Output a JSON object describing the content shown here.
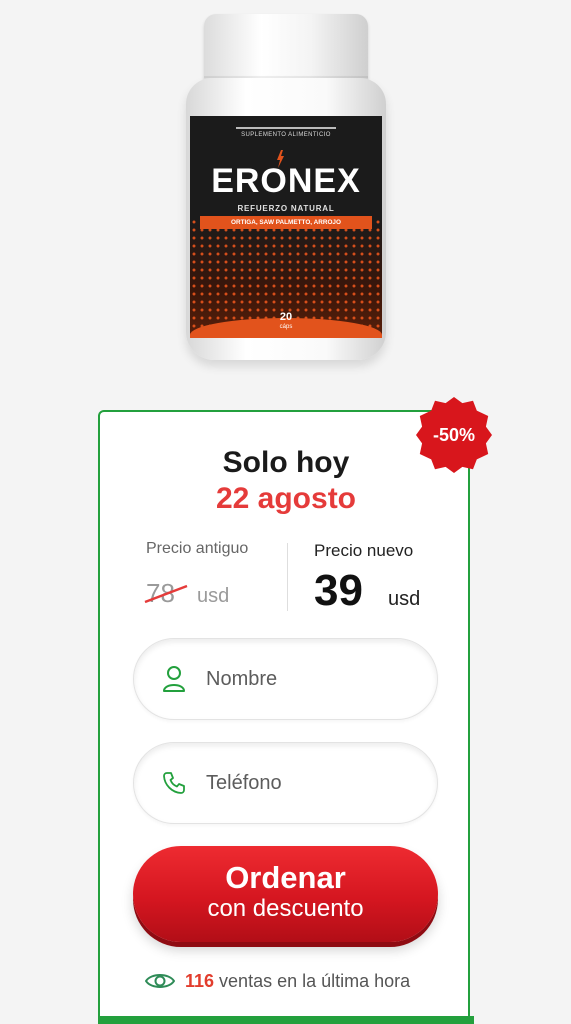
{
  "product": {
    "brand": "ERONEX",
    "label_top": "SUPLEMENTO ALIMENTICIO",
    "tagline": "REFUERZO NATURAL",
    "ingredients": "ORTIGA, SAW PALMETTO, ARROJO",
    "caps_count": "20",
    "caps_unit": "cáps"
  },
  "offer": {
    "discount_badge": "-50%",
    "title_line1": "Solo hoy",
    "title_line2": "22 agosto",
    "old_price_label": "Precio antiguo",
    "old_price_value": "78",
    "old_price_unit": "usd",
    "new_price_label": "Precio nuevo",
    "new_price_value": "39",
    "new_price_unit": "usd"
  },
  "form": {
    "name_placeholder": "Nombre",
    "phone_placeholder": "Teléfono",
    "submit_line1": "Ordenar",
    "submit_line2": "con descuento"
  },
  "sales": {
    "count": "116",
    "text": "ventas en la última hora"
  },
  "colors": {
    "accent_green": "#23a03d",
    "accent_red": "#d8161c",
    "date_red": "#e53b3a"
  },
  "icons": [
    "user-icon",
    "phone-icon",
    "eye-icon",
    "bolt-icon"
  ]
}
